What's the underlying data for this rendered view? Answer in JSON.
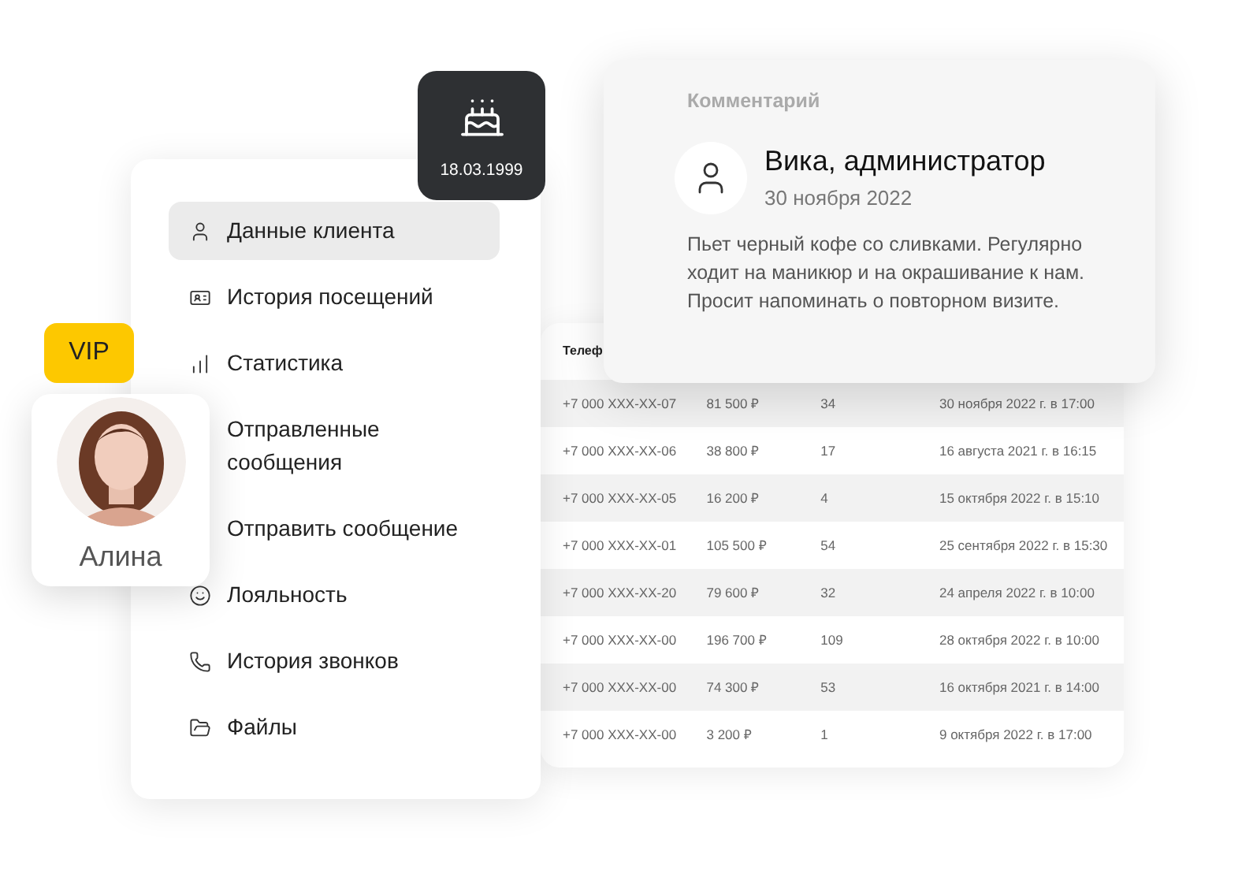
{
  "table": {
    "columns": [
      {
        "label": "Телеф"
      }
    ],
    "rows": [
      {
        "cells": [
          "+7 000 XXX-XX-07",
          "81 500 ₽",
          "34",
          "30 ноября 2022 г. в 17:00"
        ]
      },
      {
        "cells": [
          "+7 000 XXX-XX-06",
          "38 800 ₽",
          "17",
          "16 августа 2021 г. в 16:15"
        ]
      },
      {
        "cells": [
          "+7 000 XXX-XX-05",
          "16 200 ₽",
          "4",
          "15 октября 2022 г. в 15:10"
        ]
      },
      {
        "cells": [
          "+7 000 XXX-XX-01",
          "105 500 ₽",
          "54",
          "25 сентября 2022 г. в 15:30"
        ]
      },
      {
        "cells": [
          "+7 000 XXX-XX-20",
          "79 600 ₽",
          "32",
          "24 апреля 2022 г. в 10:00"
        ]
      },
      {
        "cells": [
          "+7 000 XXX-XX-00",
          "196 700 ₽",
          "109",
          "28 октября 2022 г. в 10:00"
        ]
      },
      {
        "cells": [
          "+7 000 XXX-XX-00",
          "74 300 ₽",
          "53",
          "16 октября 2021 г. в 14:00"
        ]
      },
      {
        "cells": [
          "+7 000 XXX-XX-00",
          "3 200 ₽",
          "1",
          "9 октября 2022 г. в 17:00"
        ]
      }
    ]
  },
  "menu": {
    "items": [
      {
        "label": "Данные клиента",
        "selected": true
      },
      {
        "label": "История посещений",
        "selected": false
      },
      {
        "label": "Статистика",
        "selected": false
      },
      {
        "label": "Отправленные сообщения",
        "selected": false
      },
      {
        "label": "Отправить сообщение",
        "selected": false
      },
      {
        "label": "Лояльность",
        "selected": false
      },
      {
        "label": "История звонков",
        "selected": false
      },
      {
        "label": "Файлы",
        "selected": false
      }
    ]
  },
  "birthday": {
    "date": "18.03.1999"
  },
  "comment": {
    "heading": "Комментарий",
    "author": "Вика, администратор",
    "date": "30 ноября 2022",
    "text": "Пьет черный кофе со сливками. Регулярно ходит на маникюр и на окрашивание к нам. Просит напоминать о повторном визите."
  },
  "client": {
    "badge": "VIP",
    "name": "Алина"
  }
}
